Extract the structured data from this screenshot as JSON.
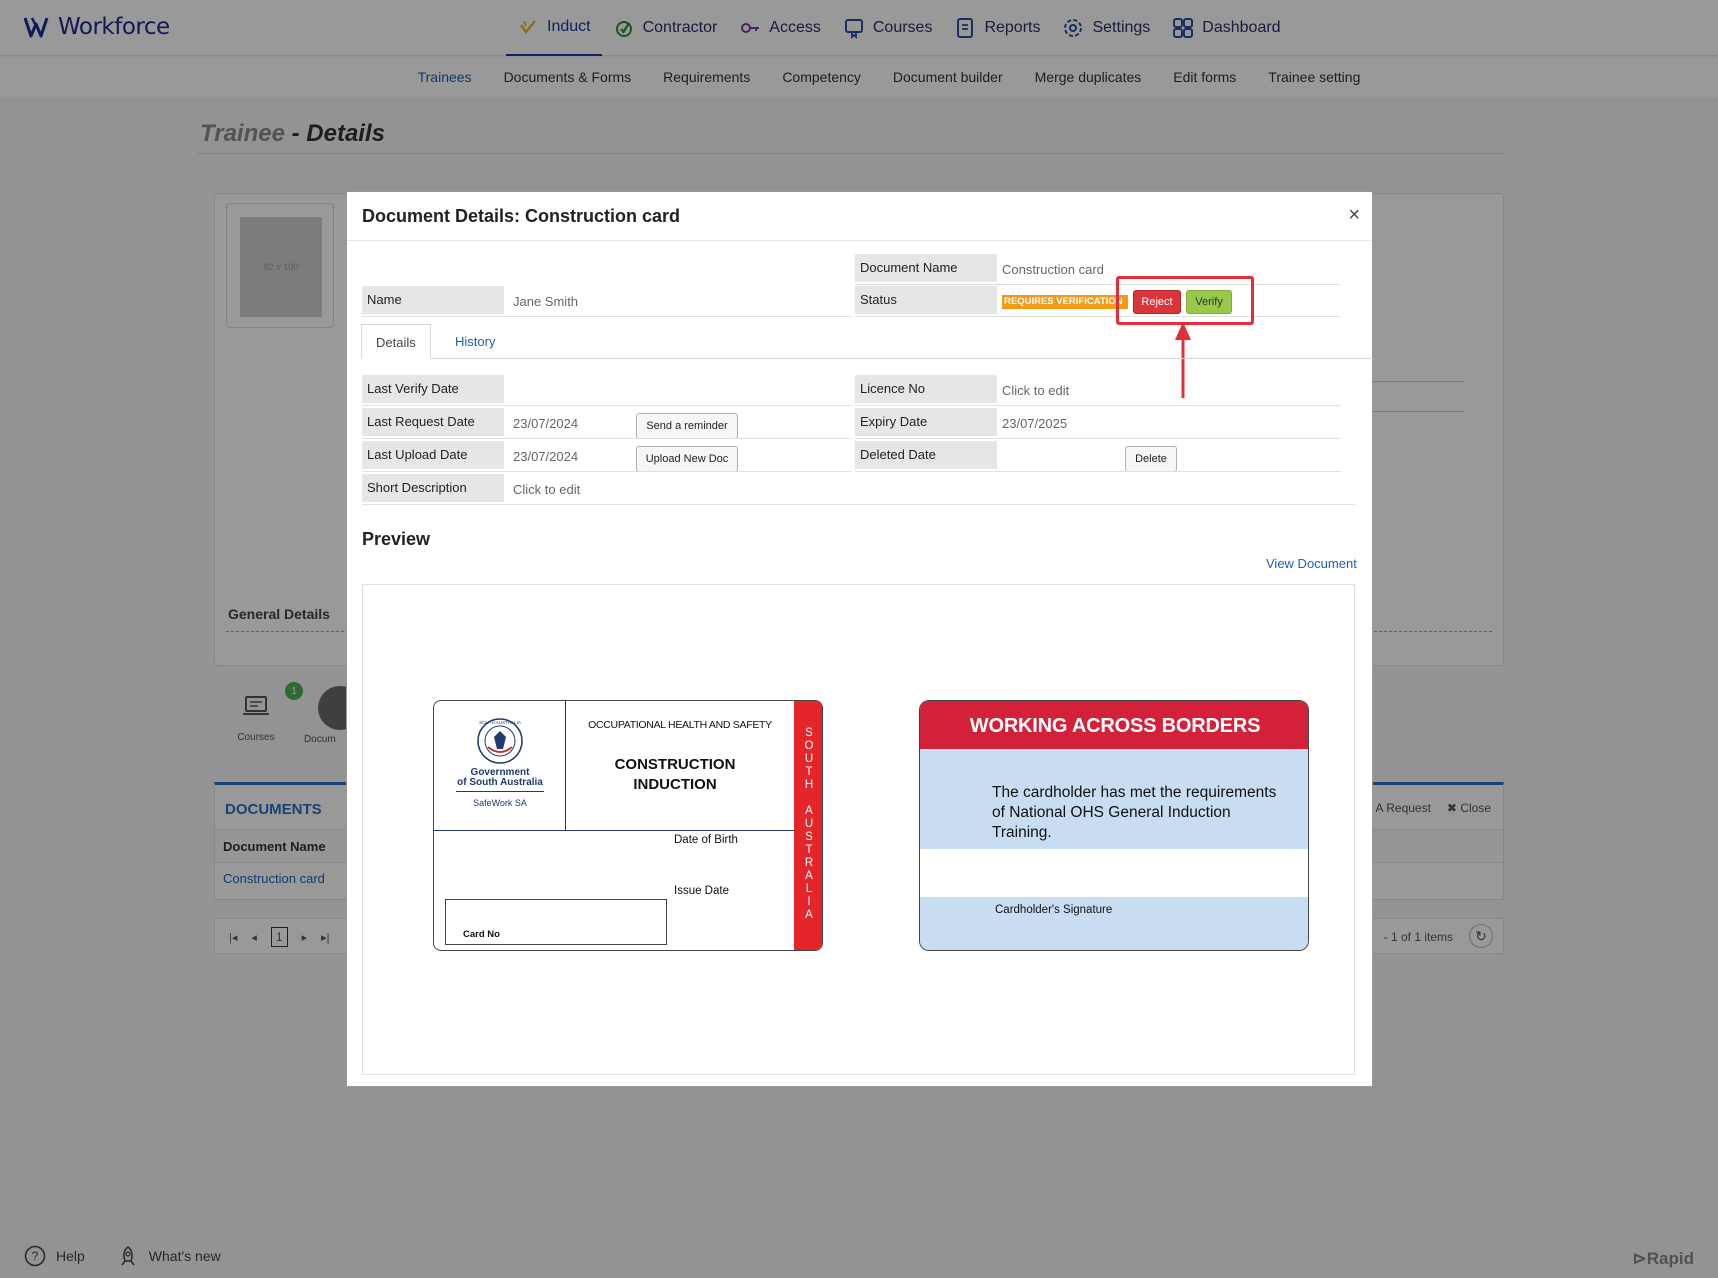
{
  "app": {
    "logo_text": "Workforce"
  },
  "nav": {
    "items": [
      {
        "label": "Induct",
        "icon": "induct-check-icon"
      },
      {
        "label": "Contractor",
        "icon": "contractor-check-icon"
      },
      {
        "label": "Access",
        "icon": "key-icon"
      },
      {
        "label": "Courses",
        "icon": "courses-icon"
      },
      {
        "label": "Reports",
        "icon": "reports-icon"
      },
      {
        "label": "Settings",
        "icon": "gear-icon"
      },
      {
        "label": "Dashboard",
        "icon": "grid-icon"
      }
    ]
  },
  "subnav": {
    "items": [
      "Trainees",
      "Documents & Forms",
      "Requirements",
      "Competency",
      "Document builder",
      "Merge duplicates",
      "Edit forms",
      "Trainee setting"
    ]
  },
  "page": {
    "title_light": "Trainee",
    "title_sep": " - ",
    "title_bold": "Details",
    "avatar_placeholder": "82 x 100",
    "general_details": "General Details",
    "tiles": [
      {
        "label": "Courses",
        "badge": "1"
      },
      {
        "label": "Docum"
      }
    ]
  },
  "documents": {
    "title": "DOCUMENTS",
    "column": "Document Name",
    "rows": [
      "Construction card"
    ],
    "action_request": "A Request",
    "action_close": "Close",
    "pager_page": "1",
    "pager_info": "- 1 of 1 items"
  },
  "footer": {
    "help": "Help",
    "whats_new": "What's new",
    "brand": "Rapid"
  },
  "modal": {
    "title": "Document Details: Construction card",
    "close": "×",
    "document_name_label": "Document Name",
    "document_name_value": "Construction card",
    "name_label": "Name",
    "name_value": "Jane Smith",
    "status_label": "Status",
    "status_value": "REQUIRES VERIFICATION",
    "reject": "Reject",
    "verify": "Verify",
    "tabs": [
      "Details",
      "History"
    ],
    "fields": {
      "last_verify_date": {
        "label": "Last Verify Date",
        "value": ""
      },
      "last_request_date": {
        "label": "Last Request Date",
        "value": "23/07/2024"
      },
      "last_upload_date": {
        "label": "Last Upload Date",
        "value": "23/07/2024"
      },
      "short_description": {
        "label": "Short Description",
        "value": "Click to edit"
      },
      "licence_no": {
        "label": "Licence No",
        "value": "Click to edit"
      },
      "expiry_date": {
        "label": "Expiry Date",
        "value": "23/07/2025"
      },
      "deleted_date": {
        "label": "Deleted Date",
        "value": ""
      }
    },
    "send_reminder": "Send a reminder",
    "upload_new_doc": "Upload New Doc",
    "delete": "Delete",
    "preview_title": "Preview",
    "view_document": "View Document"
  },
  "card_front": {
    "crest_text": "SOUTH AUSTRALIA",
    "gov_line1": "Government",
    "gov_line2": "of South Australia",
    "safework": "SafeWork SA",
    "ohs": "OCCUPATIONAL HEALTH AND SAFETY",
    "ci_line1": "CONSTRUCTION",
    "ci_line2": "INDUCTION",
    "vertical": "SOUTH AUSTRALIA",
    "dob": "Date of Birth",
    "issue": "Issue Date",
    "card_no": "Card No"
  },
  "card_back": {
    "heading": "WORKING ACROSS BORDERS",
    "text": "The cardholder has met the requirements of National OHS General Induction Training.",
    "signature": "Cardholder's Signature"
  },
  "colors": {
    "accent": "#1f3a9e",
    "badge": "#f39a17",
    "reject": "#d9353a",
    "verify": "#97c84a",
    "annotation": "#e02e3a"
  }
}
